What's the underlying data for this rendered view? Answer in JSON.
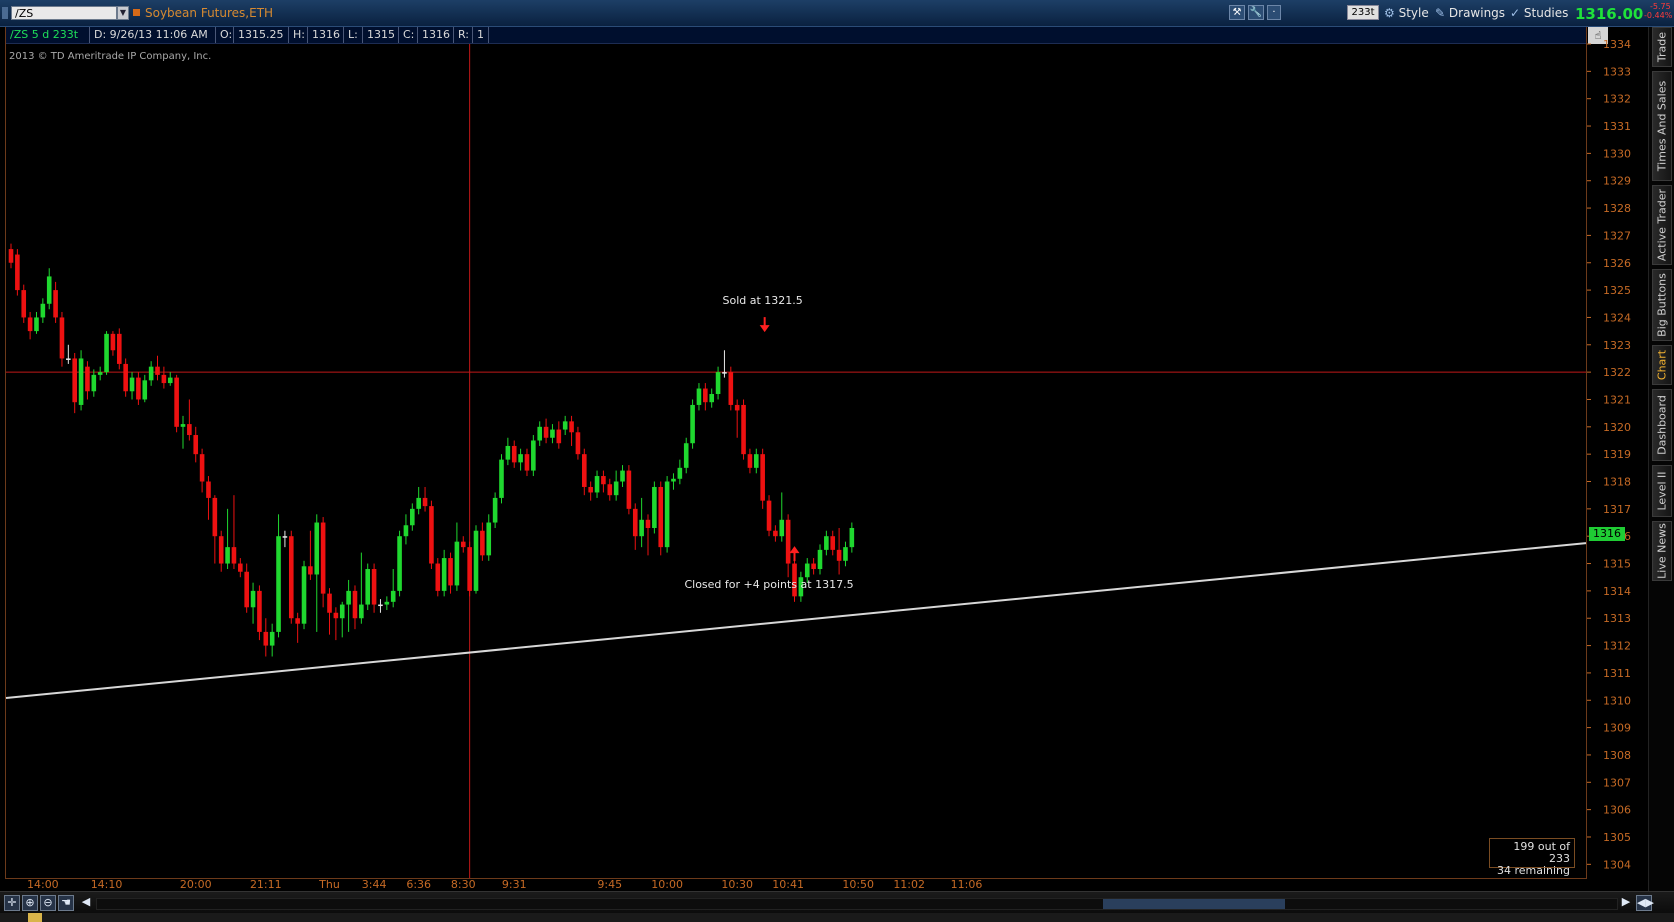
{
  "toolbar": {
    "symbol": "/ZS",
    "description": "Soybean Futures,ETH",
    "aggregation": "233t",
    "style_label": "Style",
    "drawings_label": "Drawings",
    "studies_label": "Studies",
    "last_price": "1316.00",
    "net_change": "-5.75",
    "percent_change": "-0.44%"
  },
  "infobar": {
    "symbol_period": "/ZS 5 d 233t",
    "date": "D: 9/26/13 11:06 AM",
    "open_label": "O:",
    "open": "1315.25",
    "high_label": "H:",
    "high": "1316",
    "low_label": "L:",
    "low": "1315",
    "close_label": "C:",
    "close": "1316",
    "range_label": "R:",
    "range": "1"
  },
  "copyright": "2013 © TD Ameritrade IP Company, Inc.",
  "remaining": {
    "line1": "199 out of 233",
    "line2": "34  remaining"
  },
  "price_tag": "1316",
  "sidebar_tabs": [
    "Trade",
    "Times And Sales",
    "Active Trader",
    "Big Buttons",
    "Chart",
    "Dashboard",
    "Level II",
    "Live News"
  ],
  "colors": {
    "up": "#1fd82f",
    "down": "#ee1111",
    "axis": "#c66a25",
    "trendline": "#d8d8d8",
    "hline": "#c01818"
  },
  "chart_data": {
    "type": "candlestick",
    "title": "",
    "ylim": [
      1303.5,
      1334
    ],
    "y_ticks": [
      1304,
      1305,
      1306,
      1307,
      1308,
      1309,
      1310,
      1311,
      1312,
      1313,
      1314,
      1315,
      1316,
      1317,
      1318,
      1319,
      1320,
      1321,
      1322,
      1323,
      1324,
      1325,
      1326,
      1327,
      1328,
      1329,
      1330,
      1331,
      1332,
      1333,
      1334
    ],
    "x_tick_labels": [
      "14:00",
      "14:10",
      "20:00",
      "21:11",
      "Thu",
      "3:44",
      "6:36",
      "8:30",
      "9:31",
      "9:45",
      "10:00",
      "10:30",
      "10:41",
      "10:50",
      "11:02",
      "11:06"
    ],
    "x_tick_bar_index": [
      5,
      15,
      29,
      40,
      50,
      57,
      64,
      71,
      79,
      94,
      103,
      114,
      122,
      133,
      141,
      150
    ],
    "bar_count": 233,
    "candles": [
      [
        1326.5,
        1326,
        1326.7,
        1325.8
      ],
      [
        1326.3,
        1325,
        1326.5,
        1324.8
      ],
      [
        1325,
        1324,
        1325.2,
        1323.8
      ],
      [
        1324,
        1323.5,
        1324.2,
        1323.2
      ],
      [
        1323.5,
        1324,
        1324.2,
        1323.4
      ],
      [
        1324,
        1324.5,
        1324.7,
        1323.8
      ],
      [
        1324.5,
        1325.5,
        1325.8,
        1324.3
      ],
      [
        1325,
        1324,
        1325.3,
        1323.8
      ],
      [
        1324,
        1322.5,
        1324.2,
        1322.2
      ],
      [
        1322.5,
        1322.5,
        1323,
        1322.3
      ],
      [
        1322.5,
        1320.9,
        1322.7,
        1320.5
      ],
      [
        1320.8,
        1322.5,
        1322.8,
        1320.6
      ],
      [
        1322.2,
        1321.3,
        1322.4,
        1321
      ],
      [
        1321.3,
        1321.9,
        1322.1,
        1321.1
      ],
      [
        1321.9,
        1322,
        1322.2,
        1321.7
      ],
      [
        1322,
        1323.4,
        1323.5,
        1321.9
      ],
      [
        1323.4,
        1322.8,
        1323.5,
        1322.6
      ],
      [
        1323.4,
        1322.3,
        1323.6,
        1322.1
      ],
      [
        1322.3,
        1321.3,
        1322.5,
        1321.1
      ],
      [
        1321.3,
        1321.8,
        1322,
        1321
      ],
      [
        1321.8,
        1321,
        1322,
        1320.8
      ],
      [
        1321,
        1321.7,
        1321.9,
        1320.9
      ],
      [
        1321.7,
        1322.2,
        1322.4,
        1321.5
      ],
      [
        1322.2,
        1321.9,
        1322.6,
        1321.7
      ],
      [
        1321.9,
        1321.6,
        1322.2,
        1321.4
      ],
      [
        1321.6,
        1321.8,
        1322,
        1321.5
      ],
      [
        1321.8,
        1320,
        1321.9,
        1319.8
      ],
      [
        1320,
        1320.1,
        1320.4,
        1319.2
      ],
      [
        1320.1,
        1319.7,
        1321,
        1319.5
      ],
      [
        1319.7,
        1319,
        1320,
        1318.7
      ],
      [
        1319,
        1318,
        1319.2,
        1317.6
      ],
      [
        1318,
        1317.4,
        1318.2,
        1316.6
      ],
      [
        1317.4,
        1316,
        1317.5,
        1315
      ],
      [
        1316,
        1315,
        1316.2,
        1314.7
      ],
      [
        1315,
        1315.6,
        1317,
        1314.8
      ],
      [
        1315.6,
        1315,
        1317.5,
        1314.8
      ],
      [
        1315,
        1314.7,
        1315.2,
        1314.5
      ],
      [
        1314.7,
        1313.4,
        1315,
        1313.2
      ],
      [
        1313.4,
        1314,
        1314.3,
        1312.8
      ],
      [
        1314,
        1312.5,
        1314.2,
        1312.2
      ],
      [
        1312.5,
        1312,
        1313,
        1311.6
      ],
      [
        1312,
        1312.5,
        1312.8,
        1311.6
      ],
      [
        1312.5,
        1316,
        1316.8,
        1312.3
      ],
      [
        1316,
        1316,
        1316.2,
        1315.6
      ],
      [
        1316,
        1313,
        1316.2,
        1312.8
      ],
      [
        1313,
        1312.8,
        1313.2,
        1312.1
      ],
      [
        1312.8,
        1314.9,
        1315.1,
        1312.6
      ],
      [
        1314.9,
        1314.6,
        1316.2,
        1314.4
      ],
      [
        1314.6,
        1316.5,
        1316.8,
        1312.5
      ],
      [
        1316.5,
        1313.9,
        1316.7,
        1313.4
      ],
      [
        1313.9,
        1313.2,
        1314.1,
        1312.4
      ],
      [
        1313.2,
        1313,
        1313.4,
        1312.2
      ],
      [
        1313,
        1313.5,
        1313.6,
        1312.3
      ],
      [
        1313.5,
        1314,
        1314.4,
        1312.5
      ],
      [
        1314,
        1313,
        1314.2,
        1312.6
      ],
      [
        1313,
        1313.5,
        1315.4,
        1312.8
      ],
      [
        1313.5,
        1314.8,
        1315,
        1313.3
      ],
      [
        1314.8,
        1313.5,
        1315,
        1313.2
      ],
      [
        1313.5,
        1313.5,
        1313.7,
        1313.2
      ],
      [
        1313.5,
        1313.6,
        1313.8,
        1313.3
      ],
      [
        1313.6,
        1314,
        1314.8,
        1313.4
      ],
      [
        1314,
        1316,
        1316.2,
        1313.8
      ],
      [
        1316,
        1316.4,
        1316.8,
        1315.7
      ],
      [
        1316.4,
        1317,
        1317.2,
        1316.2
      ],
      [
        1317,
        1317.4,
        1317.8,
        1316.8
      ],
      [
        1317.4,
        1317.1,
        1317.8,
        1316.9
      ],
      [
        1317.1,
        1315,
        1317.3,
        1314.8
      ],
      [
        1315,
        1314,
        1315.2,
        1313.8
      ],
      [
        1314,
        1315.2,
        1315.5,
        1313.8
      ],
      [
        1315.2,
        1314.2,
        1315.4,
        1313.9
      ],
      [
        1314.2,
        1315.8,
        1316.5,
        1314
      ],
      [
        1315.8,
        1315.6,
        1316,
        1315.4
      ],
      [
        1315.6,
        1314,
        1315.8,
        1313.8
      ],
      [
        1314,
        1316.2,
        1316.4,
        1313.9
      ],
      [
        1316.2,
        1315.3,
        1316.5,
        1315.1
      ],
      [
        1315.3,
        1316.5,
        1316.8,
        1315.1
      ],
      [
        1316.5,
        1317.4,
        1317.6,
        1316.3
      ],
      [
        1317.4,
        1318.8,
        1319,
        1317.2
      ],
      [
        1318.8,
        1319.3,
        1319.6,
        1318.6
      ],
      [
        1319.3,
        1318.7,
        1319.5,
        1318.5
      ],
      [
        1318.7,
        1319,
        1319.2,
        1318.4
      ],
      [
        1319,
        1318.4,
        1319.2,
        1318.2
      ],
      [
        1318.4,
        1319.5,
        1319.7,
        1318.2
      ],
      [
        1319.5,
        1320,
        1320.2,
        1319.3
      ],
      [
        1320,
        1319.6,
        1320.3,
        1319.4
      ],
      [
        1319.6,
        1319.9,
        1320.1,
        1319.4
      ],
      [
        1319.9,
        1319.4,
        1320.2,
        1319.2
      ],
      [
        1319.9,
        1320.2,
        1320.4,
        1319.7
      ],
      [
        1320.2,
        1319.8,
        1320.4,
        1319.3
      ],
      [
        1319.8,
        1319,
        1320,
        1318.8
      ],
      [
        1319,
        1317.8,
        1319.2,
        1317.5
      ],
      [
        1317.8,
        1317.6,
        1318,
        1317.3
      ],
      [
        1317.6,
        1318.2,
        1318.4,
        1317.4
      ],
      [
        1318.2,
        1317.9,
        1318.4,
        1317.6
      ],
      [
        1317.9,
        1317.5,
        1318.1,
        1317.3
      ],
      [
        1317.5,
        1318,
        1318.4,
        1317.3
      ],
      [
        1318,
        1318.4,
        1318.6,
        1317.8
      ],
      [
        1318.4,
        1317,
        1318.6,
        1316.8
      ],
      [
        1317,
        1316,
        1317.2,
        1315.5
      ],
      [
        1316,
        1316.6,
        1317.4,
        1315.6
      ],
      [
        1316.6,
        1316.3,
        1316.8,
        1315.3
      ],
      [
        1316.3,
        1317.8,
        1318,
        1316.1
      ],
      [
        1317.8,
        1315.6,
        1318,
        1315.3
      ],
      [
        1315.6,
        1318,
        1318.2,
        1315.4
      ],
      [
        1318,
        1318.1,
        1318.3,
        1317.7
      ],
      [
        1318.1,
        1318.5,
        1318.8,
        1317.9
      ],
      [
        1318.5,
        1319.4,
        1319.6,
        1318.3
      ],
      [
        1319.4,
        1320.8,
        1321,
        1319.2
      ],
      [
        1320.8,
        1321.4,
        1321.6,
        1320.6
      ],
      [
        1321.4,
        1320.9,
        1321.6,
        1320.6
      ],
      [
        1320.9,
        1321.2,
        1321.4,
        1320.7
      ],
      [
        1321.2,
        1322,
        1322.2,
        1321
      ],
      [
        1322,
        1322,
        1322.8,
        1321.8
      ],
      [
        1322,
        1320.8,
        1322.2,
        1320.6
      ],
      [
        1320.8,
        1320.6,
        1321,
        1319.6
      ],
      [
        1320.8,
        1319,
        1321,
        1318.8
      ],
      [
        1319,
        1318.5,
        1319.2,
        1318.3
      ],
      [
        1318.5,
        1319,
        1319.2,
        1318.3
      ],
      [
        1319,
        1317.3,
        1319.2,
        1317
      ],
      [
        1317.3,
        1316.2,
        1317.5,
        1316
      ],
      [
        1316.2,
        1316,
        1316.4,
        1315.8
      ],
      [
        1316,
        1316.6,
        1317.6,
        1315.8
      ],
      [
        1316.6,
        1315,
        1316.8,
        1314.5
      ],
      [
        1315,
        1313.8,
        1315.2,
        1313.6
      ],
      [
        1313.8,
        1314.5,
        1314.7,
        1313.6
      ],
      [
        1314.5,
        1315,
        1315.2,
        1314.3
      ],
      [
        1315,
        1314.8,
        1315.2,
        1314.6
      ],
      [
        1314.8,
        1315.5,
        1315.7,
        1314.6
      ],
      [
        1315.5,
        1316,
        1316.2,
        1315.3
      ],
      [
        1316,
        1315.5,
        1316.2,
        1315.3
      ],
      [
        1315.5,
        1315.1,
        1316.3,
        1314.6
      ],
      [
        1315.1,
        1315.6,
        1315.8,
        1314.9
      ],
      [
        1315.6,
        1316.3,
        1316.5,
        1315.4
      ]
    ],
    "horizontal_line": 1322,
    "trendline": {
      "start": [
        0,
        1310.1
      ],
      "end": [
        232,
        1315.4
      ]
    },
    "vertical_line_bar": 72,
    "annotations": [
      {
        "text": "Sold at 1321.5",
        "bar": 118,
        "price": 1324.5,
        "arrow": "down",
        "arrow_price": 1323.5
      },
      {
        "text": "Closed for +4 points at 1317.5",
        "bar": 119,
        "price": 1314.1,
        "arrow": "up",
        "arrow_price": 1315.6
      }
    ]
  }
}
